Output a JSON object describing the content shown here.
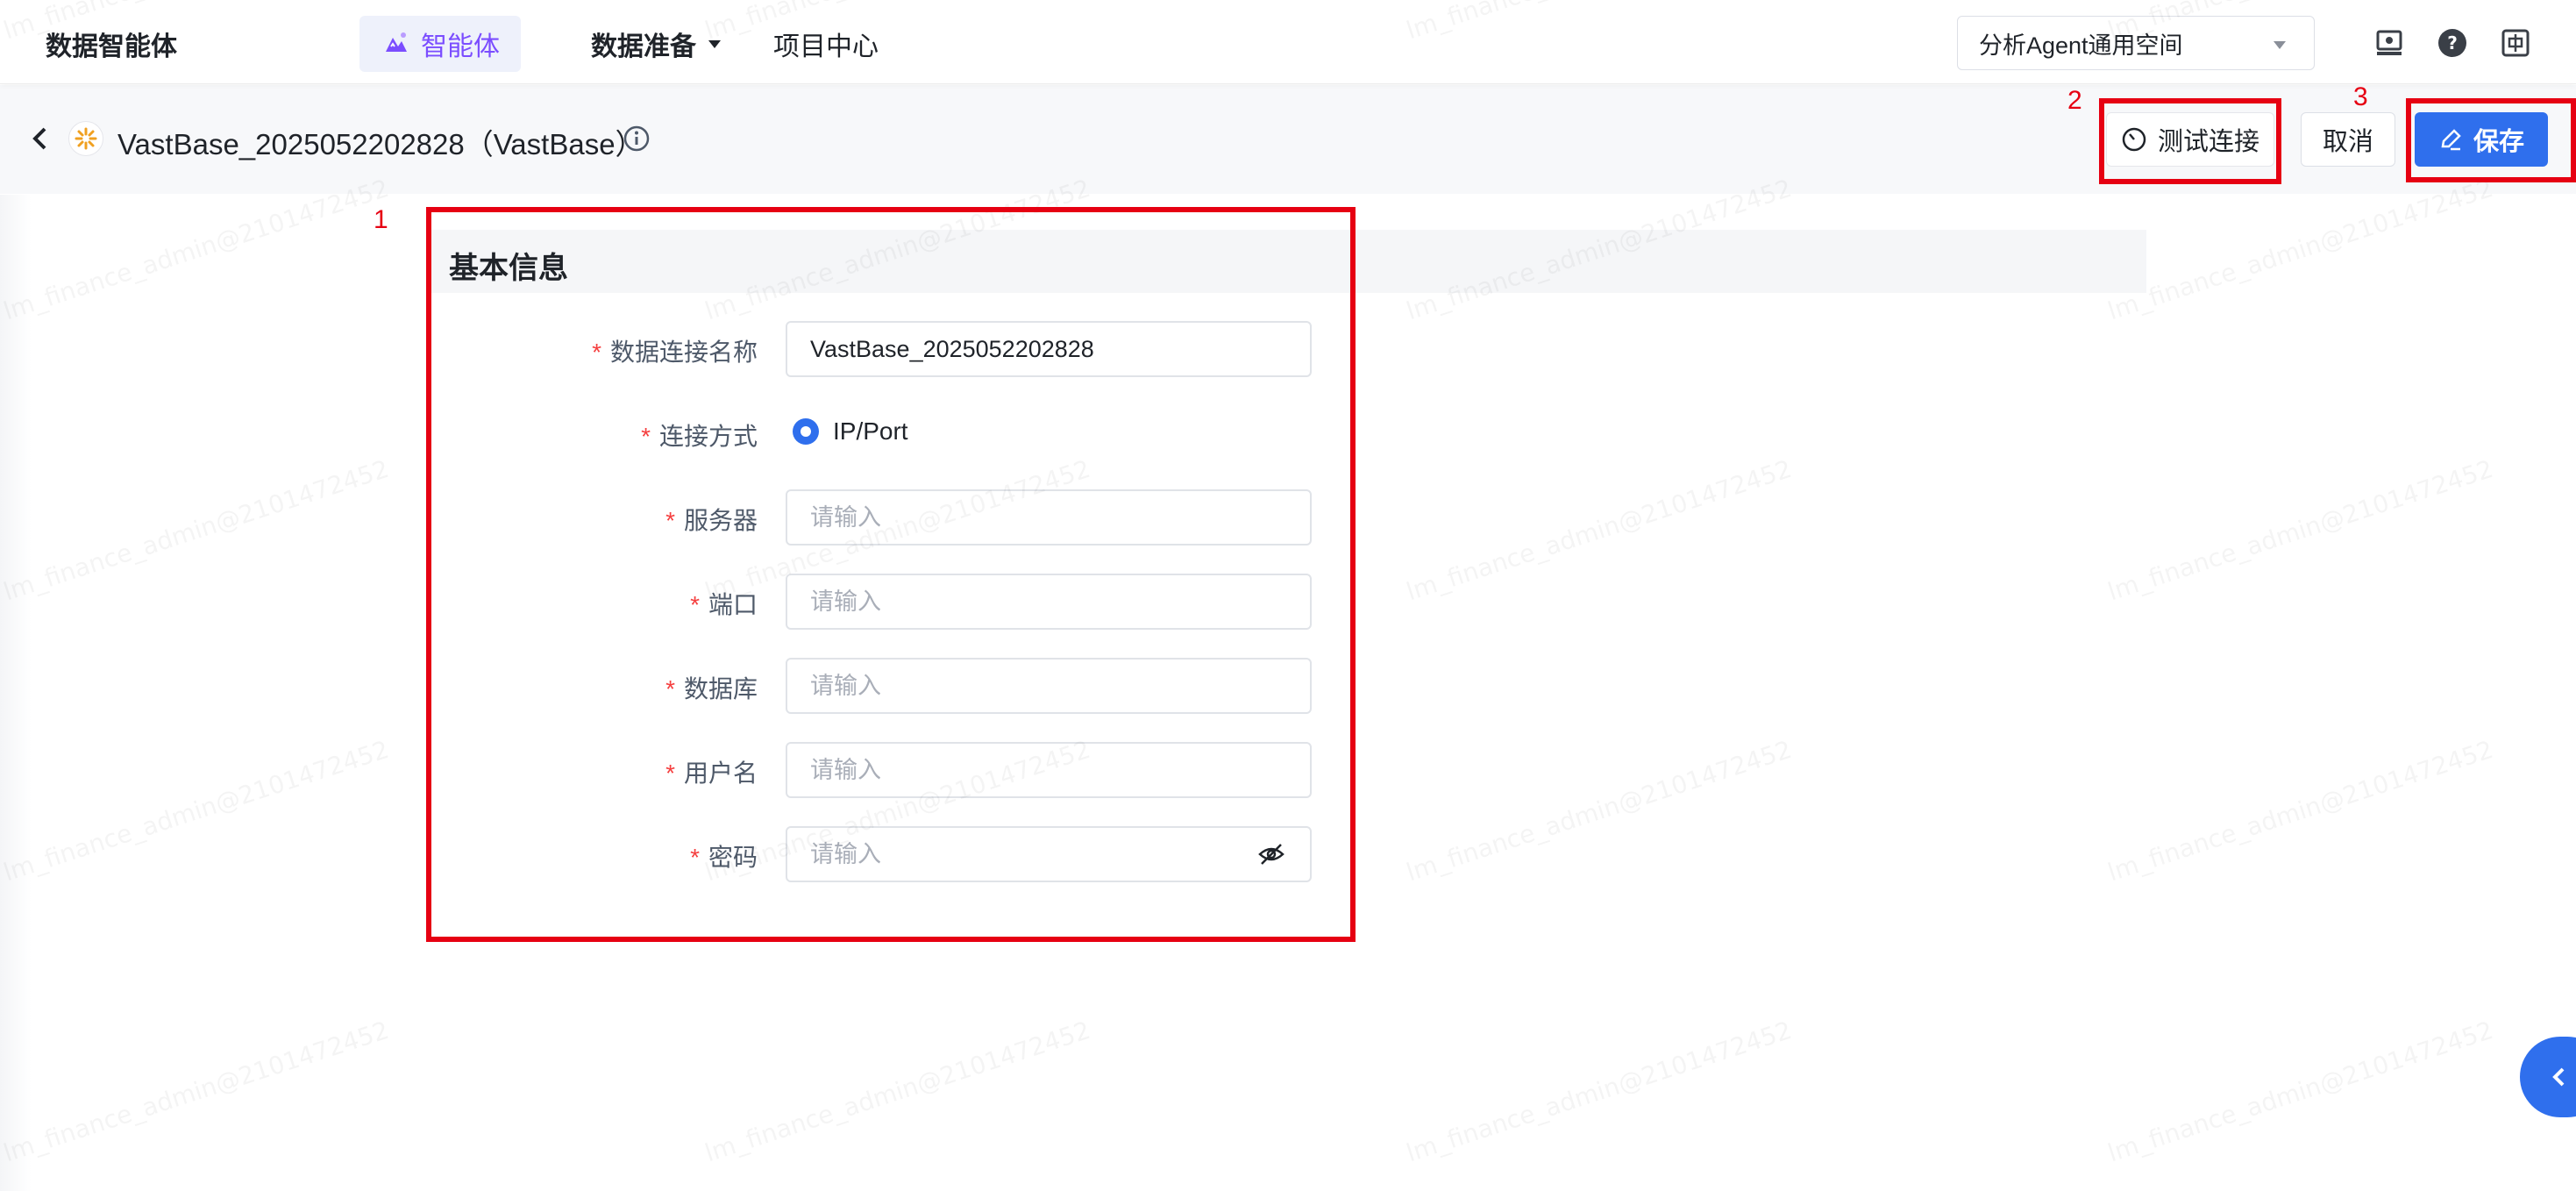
{
  "nav": {
    "brand": "数据智能体",
    "active_item": "智能体",
    "items": [
      "数据准备",
      "项目中心"
    ],
    "space_select": "分析Agent通用空间"
  },
  "header": {
    "title": "VastBase_2025052202828（VastBase）",
    "buttons": {
      "test": "测试连接",
      "cancel": "取消",
      "save": "保存"
    }
  },
  "annotations": [
    "1",
    "2",
    "3"
  ],
  "form": {
    "section_title": "基本信息",
    "required_mark": "*",
    "fields": [
      {
        "label": "数据连接名称",
        "value": "VastBase_2025052202828",
        "placeholder": ""
      },
      {
        "label": "连接方式",
        "option": "IP/Port"
      },
      {
        "label": "服务器",
        "value": "",
        "placeholder": "请输入"
      },
      {
        "label": "端口",
        "value": "",
        "placeholder": "请输入"
      },
      {
        "label": "数据库",
        "value": "",
        "placeholder": "请输入"
      },
      {
        "label": "用户名",
        "value": "",
        "placeholder": "请输入"
      },
      {
        "label": "密码",
        "value": "",
        "placeholder": "请输入"
      }
    ]
  },
  "watermark": "lm_finance_admin@2101472452",
  "colors": {
    "primary": "#2f6fed",
    "accent_purple": "#7b4dff",
    "annotation_red": "#e60012",
    "required_red": "#f53f3f"
  },
  "icons": [
    "agent-icon",
    "back-icon",
    "database-icon",
    "info-icon",
    "timer-icon",
    "edit-icon",
    "eye-off-icon",
    "help-icon",
    "language-icon",
    "monitor-icon",
    "chevron-left-icon"
  ]
}
